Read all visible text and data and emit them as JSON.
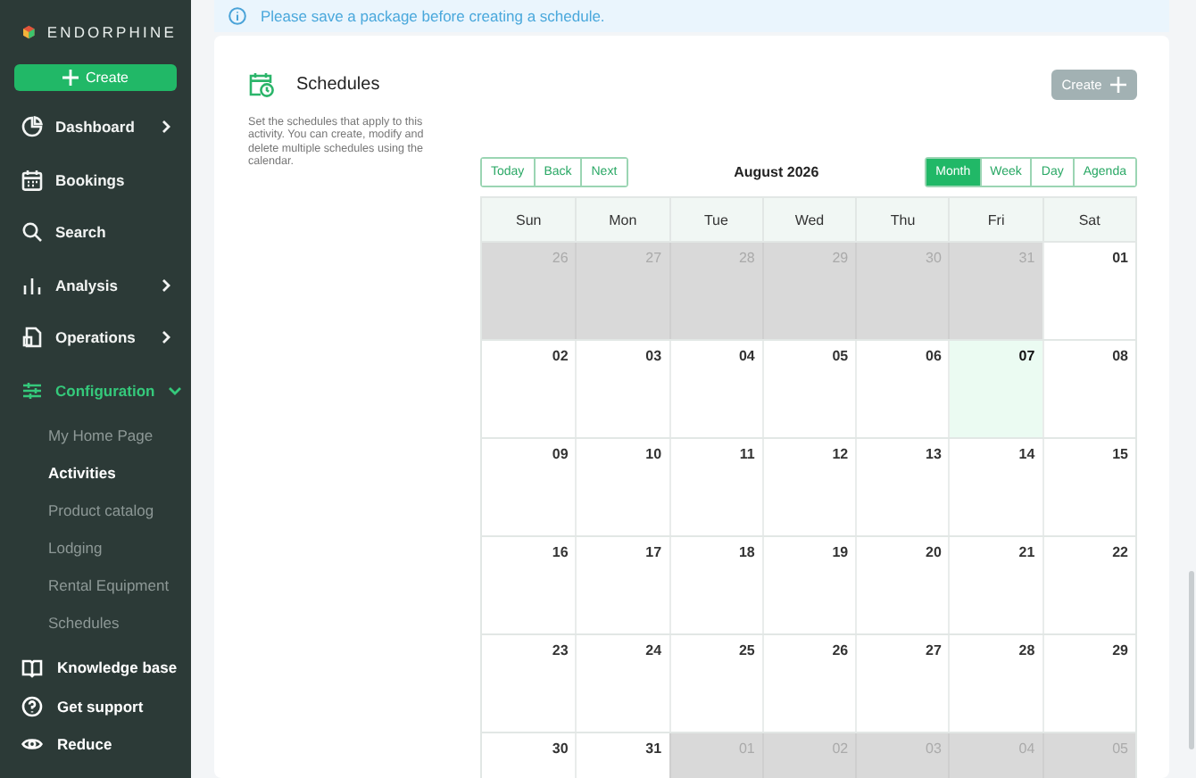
{
  "sidebar": {
    "brand": "ENDORPHINE",
    "create_button": "Create",
    "items": [
      {
        "label": "Dashboard",
        "kind": "group",
        "expanded": false,
        "selected": false
      },
      {
        "label": "Bookings",
        "kind": "link",
        "selected": false
      },
      {
        "label": "Search",
        "kind": "link",
        "selected": false
      },
      {
        "label": "Analysis",
        "kind": "group",
        "expanded": false,
        "selected": false
      },
      {
        "label": "Operations",
        "kind": "group",
        "expanded": false,
        "selected": false
      },
      {
        "label": "Configuration",
        "kind": "group",
        "expanded": true,
        "selected": true,
        "children": [
          {
            "label": "My Home Page",
            "selected": false
          },
          {
            "label": "Activities",
            "selected": true
          },
          {
            "label": "Product catalog",
            "selected": false
          },
          {
            "label": "Lodging",
            "selected": false
          },
          {
            "label": "Rental Equipment",
            "selected": false
          },
          {
            "label": "Schedules",
            "selected": false
          }
        ]
      }
    ],
    "footer": [
      {
        "label": "Knowledge base"
      },
      {
        "label": "Get support"
      },
      {
        "label": "Reduce"
      }
    ]
  },
  "banner": {
    "text": "Please save a package before creating a schedule."
  },
  "schedules": {
    "title": "Schedules",
    "description": "Set the schedules that apply to this activity. You can create, modify and delete multiple schedules using the calendar.",
    "create_button": {
      "label": "Create",
      "disabled": true
    }
  },
  "calendar": {
    "nav_buttons": [
      "Today",
      "Back",
      "Next"
    ],
    "month_label": "August 2026",
    "views": [
      {
        "label": "Month",
        "selected": true
      },
      {
        "label": "Week",
        "selected": false
      },
      {
        "label": "Day",
        "selected": false
      },
      {
        "label": "Agenda",
        "selected": false
      }
    ],
    "weekdays": [
      "Sun",
      "Mon",
      "Tue",
      "Wed",
      "Thu",
      "Fri",
      "Sat"
    ],
    "weeks": [
      [
        {
          "day": "26",
          "outside": true,
          "today": false
        },
        {
          "day": "27",
          "outside": true,
          "today": false
        },
        {
          "day": "28",
          "outside": true,
          "today": false
        },
        {
          "day": "29",
          "outside": true,
          "today": false
        },
        {
          "day": "30",
          "outside": true,
          "today": false
        },
        {
          "day": "31",
          "outside": true,
          "today": false
        },
        {
          "day": "01",
          "outside": false,
          "today": false
        }
      ],
      [
        {
          "day": "02",
          "outside": false,
          "today": false
        },
        {
          "day": "03",
          "outside": false,
          "today": false
        },
        {
          "day": "04",
          "outside": false,
          "today": false
        },
        {
          "day": "05",
          "outside": false,
          "today": false
        },
        {
          "day": "06",
          "outside": false,
          "today": false
        },
        {
          "day": "07",
          "outside": false,
          "today": true
        },
        {
          "day": "08",
          "outside": false,
          "today": false
        }
      ],
      [
        {
          "day": "09",
          "outside": false,
          "today": false
        },
        {
          "day": "10",
          "outside": false,
          "today": false
        },
        {
          "day": "11",
          "outside": false,
          "today": false
        },
        {
          "day": "12",
          "outside": false,
          "today": false
        },
        {
          "day": "13",
          "outside": false,
          "today": false
        },
        {
          "day": "14",
          "outside": false,
          "today": false
        },
        {
          "day": "15",
          "outside": false,
          "today": false
        }
      ],
      [
        {
          "day": "16",
          "outside": false,
          "today": false
        },
        {
          "day": "17",
          "outside": false,
          "today": false
        },
        {
          "day": "18",
          "outside": false,
          "today": false
        },
        {
          "day": "19",
          "outside": false,
          "today": false
        },
        {
          "day": "20",
          "outside": false,
          "today": false
        },
        {
          "day": "21",
          "outside": false,
          "today": false
        },
        {
          "day": "22",
          "outside": false,
          "today": false
        }
      ],
      [
        {
          "day": "23",
          "outside": false,
          "today": false
        },
        {
          "day": "24",
          "outside": false,
          "today": false
        },
        {
          "day": "25",
          "outside": false,
          "today": false
        },
        {
          "day": "26",
          "outside": false,
          "today": false
        },
        {
          "day": "27",
          "outside": false,
          "today": false
        },
        {
          "day": "28",
          "outside": false,
          "today": false
        },
        {
          "day": "29",
          "outside": false,
          "today": false
        }
      ],
      [
        {
          "day": "30",
          "outside": false,
          "today": false
        },
        {
          "day": "31",
          "outside": false,
          "today": false
        },
        {
          "day": "01",
          "outside": true,
          "today": false
        },
        {
          "day": "02",
          "outside": true,
          "today": false
        },
        {
          "day": "03",
          "outside": true,
          "today": false
        },
        {
          "day": "04",
          "outside": true,
          "today": false
        },
        {
          "day": "05",
          "outside": true,
          "today": false
        }
      ]
    ]
  }
}
